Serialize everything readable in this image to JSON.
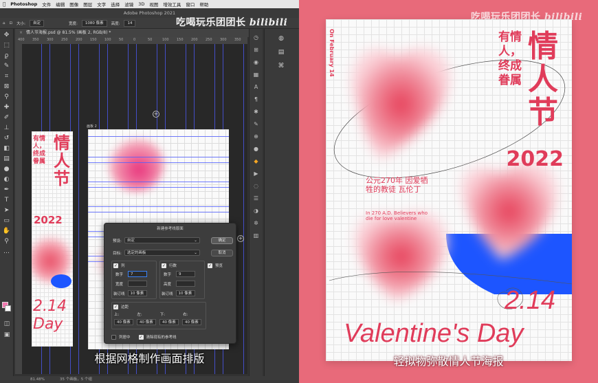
{
  "menubar": {
    "app": "Photoshop",
    "items": [
      "文件",
      "编辑",
      "图像",
      "图层",
      "文字",
      "选择",
      "滤镜",
      "3D",
      "视图",
      "增效工具",
      "窗口",
      "帮助"
    ]
  },
  "window_title": "Adobe Photoshop 2021",
  "options_bar": {
    "size_label": "大小:",
    "size_value": "自定",
    "width_label": "宽度:",
    "width_value": "1080 像素",
    "height_label": "高度:",
    "height_value": "14"
  },
  "document_tab": "情人节海报.psd @ 81.5% (画板 2, RGB/8) *",
  "ruler_ticks": [
    "400",
    "350",
    "300",
    "250",
    "200",
    "150",
    "100",
    "50",
    "0",
    "50",
    "100",
    "150",
    "200",
    "250",
    "300",
    "350"
  ],
  "artboard_label": "画板 2",
  "watermark": {
    "text": "吃喝玩乐团团长",
    "logo": "bilibili"
  },
  "mini_poster": {
    "title": "情人节",
    "slogan": "有情人，终成眷属",
    "year": "2022",
    "date": "2.14",
    "day": "Day"
  },
  "dialog": {
    "title": "新建参考线版面",
    "preset_label": "预设:",
    "preset_value": "自定",
    "target_label": "目标:",
    "target_value": "选定的画板",
    "ok": "确定",
    "cancel": "取消",
    "columns_label": "列",
    "rows_label": "行数",
    "preview_label": "预览",
    "number_label": "数字",
    "col_number": "7",
    "row_number": "9",
    "width_label": "宽度",
    "height_label": "高度",
    "gutter_label": "装订线",
    "col_gutter": "10 像素",
    "row_gutter": "10 像素",
    "margin_label": "边距",
    "top_label": "上:",
    "left_label": "左:",
    "bottom_label": "下:",
    "right_label": "右:",
    "margin_top": "40 像素",
    "margin_left": "40 像素",
    "margin_bottom": "40 像素",
    "margin_right": "40 像素",
    "center_cols_label": "列居中",
    "clear_label": "清除现有的参考线"
  },
  "statusbar": {
    "zoom": "81.48%",
    "info": "35 个画板，5 个组"
  },
  "subtitle_left": "根据网格制作画面排版",
  "poster": {
    "title": "情人节",
    "slogan": "有情人，终成眷属",
    "year": "2022",
    "side_text": "On February 14",
    "cn_story": "公元270年 因爱牺牲的教徒 瓦伦丁",
    "en_story": "In 270 A.D. Believers who die for love valentine",
    "date": "2.14",
    "headline": "Valentine's Day"
  },
  "subtitle_right": "轻拟物弥散情人节海报",
  "colors": {
    "brand_red": "#e03c5a",
    "poster_bg": "#e86a7a",
    "guide_blue": "#4e5cff",
    "accent_blue": "#1d55ff"
  }
}
